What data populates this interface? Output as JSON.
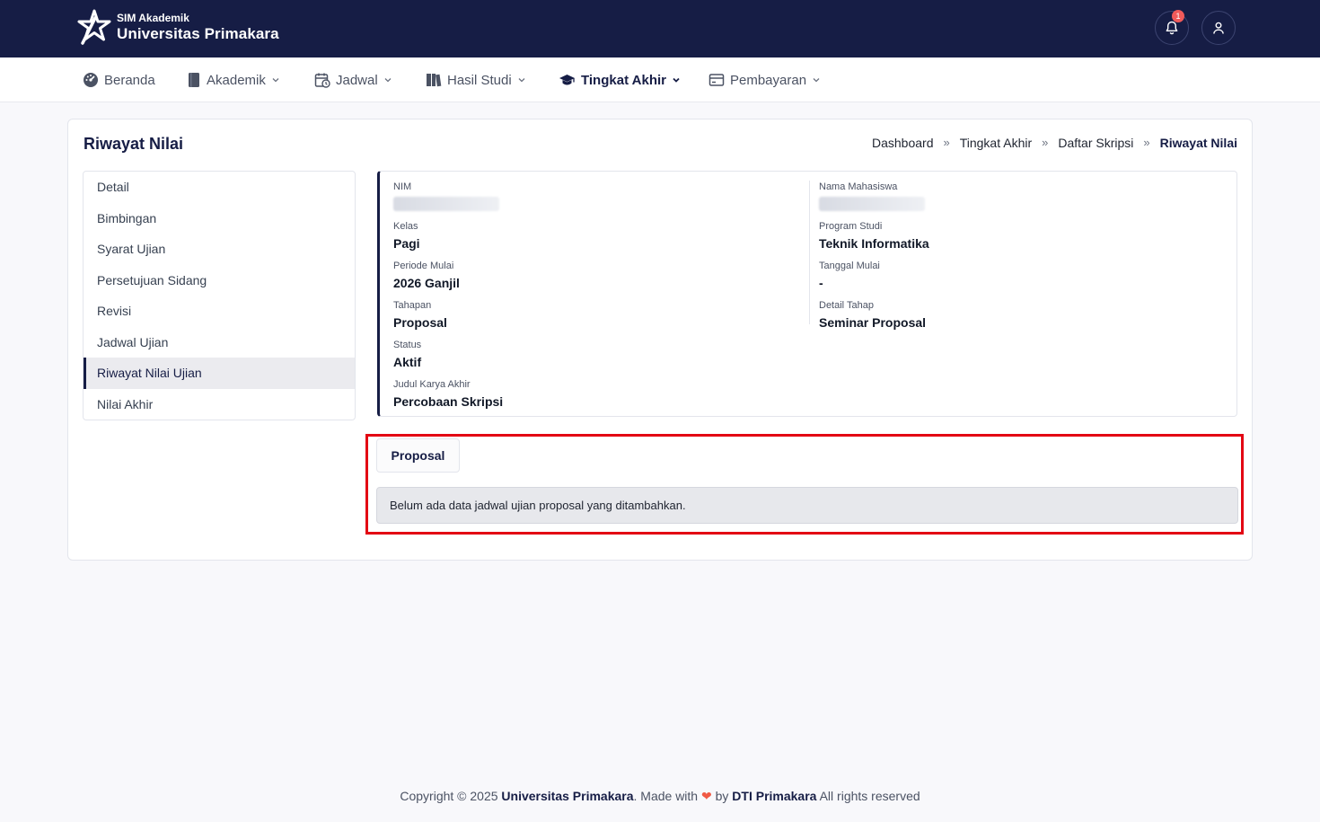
{
  "brand": {
    "subtitle": "SIM Akademik",
    "title": "Universitas Primakara"
  },
  "header": {
    "notification_count": "1"
  },
  "nav": {
    "items": [
      {
        "label": "Beranda"
      },
      {
        "label": "Akademik"
      },
      {
        "label": "Jadwal"
      },
      {
        "label": "Hasil Studi"
      },
      {
        "label": "Tingkat Akhir"
      },
      {
        "label": "Pembayaran"
      }
    ],
    "active": "Tingkat Akhir"
  },
  "page": {
    "title": "Riwayat Nilai",
    "breadcrumb": [
      "Dashboard",
      "Tingkat Akhir",
      "Daftar Skripsi",
      "Riwayat Nilai"
    ]
  },
  "sidemenu": {
    "items": [
      {
        "label": "Detail"
      },
      {
        "label": "Bimbingan"
      },
      {
        "label": "Syarat Ujian"
      },
      {
        "label": "Persetujuan Sidang"
      },
      {
        "label": "Revisi"
      },
      {
        "label": "Jadwal Ujian"
      },
      {
        "label": "Riwayat Nilai Ujian"
      },
      {
        "label": "Nilai Akhir"
      }
    ],
    "active": "Riwayat Nilai Ujian"
  },
  "info": {
    "nim": {
      "label": "NIM"
    },
    "nama": {
      "label": "Nama Mahasiswa"
    },
    "kelas": {
      "label": "Kelas",
      "value": "Pagi"
    },
    "prodi": {
      "label": "Program Studi",
      "value": "Teknik Informatika"
    },
    "periode": {
      "label": "Periode Mulai",
      "value": "2026 Ganjil"
    },
    "tanggal": {
      "label": "Tanggal Mulai",
      "value": "-"
    },
    "tahapan": {
      "label": "Tahapan",
      "value": "Proposal"
    },
    "detail_tahap": {
      "label": "Detail Tahap",
      "value": "Seminar Proposal"
    },
    "status": {
      "label": "Status",
      "value": "Aktif"
    },
    "judul": {
      "label": "Judul Karya Akhir",
      "value": "Percobaan Skripsi"
    }
  },
  "proposal": {
    "tab_label": "Proposal",
    "empty_message": "Belum ada data jadwal ujian proposal yang ditambahkan."
  },
  "footer": {
    "prefix": "Copyright © 2025",
    "org": "Universitas Primakara",
    "made_with": ". Made with",
    "by": "by",
    "team": "DTI Primakara",
    "suffix": "All rights reserved"
  },
  "colors": {
    "navy": "#161d45",
    "highlight": "#e30613",
    "heart": "#f05a45"
  }
}
